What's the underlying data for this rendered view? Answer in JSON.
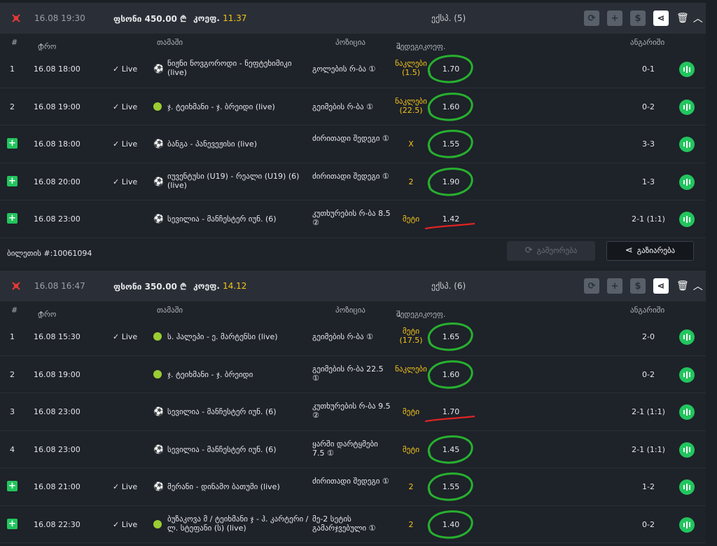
{
  "tickets": [
    {
      "datetime": "16.08   19:30",
      "stake_label": "ფსონი",
      "stake": "450.00 ₾",
      "odds_label": "კოეფ.",
      "odds": "11.37",
      "type": "ექსპ. (5)",
      "columns": {
        "num": "#",
        "time": "დრო",
        "game": "თამაში",
        "position": "პოზიცია",
        "odds": "შედეგიკოეფ.",
        "result": "ანგარიში"
      },
      "rows": [
        {
          "num": "1",
          "date": "16.08  18:00",
          "live": "✓ Live",
          "sport": "football",
          "match": "ნიჟნი ნოვგოროდი - ნეფტეხიმიკი (live)",
          "market": "გოლების რ-ბა ①",
          "pick": "ნაკლები (1.5)",
          "odds": "1.70",
          "mark": "circle",
          "score": "0-1"
        },
        {
          "num": "2",
          "date": "16.08  19:00",
          "live": "✓ Live",
          "sport": "tennis",
          "match": "ჯ. ტეიხმანი - ჯ. ბრეიდი (live)",
          "market": "გეიმების რ-ბა ①",
          "pick": "ნაკლები (22.5)",
          "odds": "1.60",
          "mark": "circle",
          "score": "0-2"
        },
        {
          "num": "",
          "date": "16.08  18:00",
          "live": "✓ Live",
          "sport": "football",
          "match": "ბანგა - პანევეჟისი (live)",
          "market": "ძირითადი შედეგი ①",
          "pick": "X",
          "odds": "1.55",
          "mark": "circle",
          "score": "3-3"
        },
        {
          "num": "",
          "date": "16.08  20:00",
          "live": "✓ Live",
          "sport": "football",
          "match": "იუვენტუსი (U19) - რეალი (U19) (6) (live)",
          "market": "ძირითადი შედეგი ①",
          "pick": "2",
          "odds": "1.90",
          "mark": "circle",
          "score": "1-3"
        },
        {
          "num": "",
          "date": "16.08  23:00",
          "live": "",
          "sport": "football",
          "match": "სევილია - მანჩესტერ იუნ. (6)",
          "market": "კუთხურების რ-ბა 8.5 ②",
          "pick": "მეტი",
          "odds": "1.42",
          "mark": "underline",
          "score": "2-1 (1:1)"
        }
      ],
      "footer": {
        "ticket_id": "ბილეთის #:10061094",
        "repeat": "გამეორება",
        "share": "გაზიარება"
      }
    },
    {
      "datetime": "16.08   16:47",
      "stake_label": "ფსონი",
      "stake": "350.00 ₾",
      "odds_label": "კოეფ.",
      "odds": "14.12",
      "type": "ექსპ. (6)",
      "columns": {
        "num": "#",
        "time": "დრო",
        "game": "თამაში",
        "position": "პოზიცია",
        "odds": "შედეგიკოეფ.",
        "result": "ანგარიში"
      },
      "rows": [
        {
          "num": "1",
          "date": "16.08  15:30",
          "live": "✓ Live",
          "sport": "tennis",
          "match": "ს. ჰალეპი - ე. მარტენსი (live)",
          "market": "გეიმების რ-ბა ①",
          "pick": "მეტი (17.5)",
          "odds": "1.65",
          "mark": "circle",
          "score": "2-0"
        },
        {
          "num": "2",
          "date": "16.08  19:00",
          "live": "",
          "sport": "tennis",
          "match": "ჯ. ტეიხმანი - ჯ. ბრეიდი",
          "market": "გეიმების რ-ბა 22.5 ①",
          "pick": "ნაკლები",
          "odds": "1.60",
          "mark": "circle",
          "score": "0-2"
        },
        {
          "num": "3",
          "date": "16.08  23:00",
          "live": "",
          "sport": "football",
          "match": "სევილია - მანჩესტერ იუნ. (6)",
          "market": "კუთხურების რ-ბა 9.5 ②",
          "pick": "მეტი",
          "odds": "1.70",
          "mark": "underline",
          "score": "2-1 (1:1)"
        },
        {
          "num": "4",
          "date": "16.08  23:00",
          "live": "",
          "sport": "football",
          "match": "სევილია - მანჩესტერ იუნ. (6)",
          "market": "ყარში დარტყმები 7.5 ①",
          "pick": "მეტი",
          "odds": "1.45",
          "mark": "circle",
          "score": "2-1 (1:1)"
        },
        {
          "num": "",
          "date": "16.08  21:00",
          "live": "✓ Live",
          "sport": "football",
          "match": "მერანი - დინამო ბათუმი (live)",
          "market": "ძირითადი შედეგი ①",
          "pick": "2",
          "odds": "1.55",
          "mark": "circle",
          "score": "1-2"
        },
        {
          "num": "",
          "date": "16.08  22:30",
          "live": "✓ Live",
          "sport": "tennis",
          "match": "ბუზაკოვა მ / ტეიხმანი ჯ - ჰ. კარტერი / ლ. სტეფანი (ს) (live)",
          "market": "მე-2 სეტის გამარჯვებული ①",
          "pick": "2",
          "odds": "1.40",
          "mark": "circle",
          "score": "0-2"
        }
      ]
    }
  ]
}
